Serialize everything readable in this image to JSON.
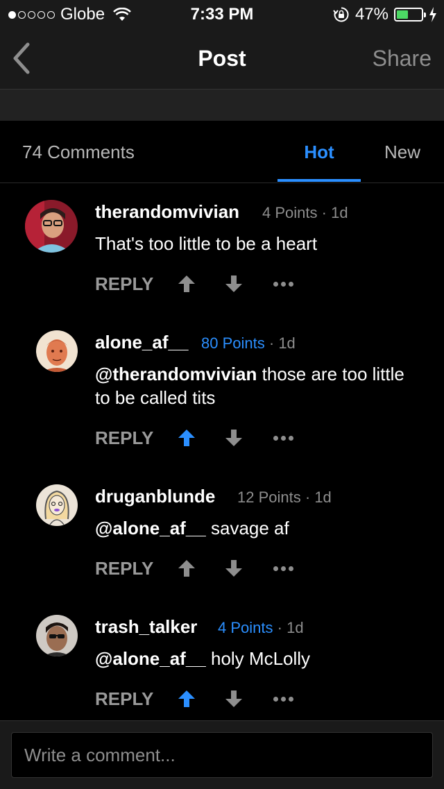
{
  "status_bar": {
    "carrier": "Globe",
    "time": "7:33 PM",
    "battery_percent": "47%",
    "battery_level": 0.47,
    "signal_bars_filled": 1,
    "signal_bars_total": 5
  },
  "nav": {
    "title": "Post",
    "share_label": "Share",
    "back_icon": "chevron-left-icon"
  },
  "tabs": {
    "comments_count": "74 Comments",
    "hot_label": "Hot",
    "new_label": "New",
    "active": "Hot"
  },
  "comments": [
    {
      "author": "therandomvivian",
      "points": "4 Points",
      "separator": "·",
      "age": "1d",
      "mention": "",
      "text": "That's too little to be a heart",
      "reply_label": "REPLY",
      "upvoted": false
    },
    {
      "author": "alone_af__",
      "points": "80 Points",
      "separator": "·",
      "age": "1d",
      "mention": "@therandomvivian",
      "text": " those are too little to be called tits",
      "reply_label": "REPLY",
      "upvoted": true
    },
    {
      "author": "druganblunde",
      "points": "12 Points",
      "separator": "·",
      "age": "1d",
      "mention": "@alone_af__",
      "text": " savage af",
      "reply_label": "REPLY",
      "upvoted": false
    },
    {
      "author": "trash_talker",
      "points": "4 Points",
      "separator": "·",
      "age": "1d",
      "mention": "@alone_af__",
      "text": " holy McLolly",
      "reply_label": "REPLY",
      "upvoted": true
    }
  ],
  "input": {
    "placeholder": "Write a comment...",
    "value": ""
  },
  "colors": {
    "accent": "#2b8fff",
    "background": "#000000",
    "muted": "#8e8e8e",
    "battery": "#4cd964"
  }
}
